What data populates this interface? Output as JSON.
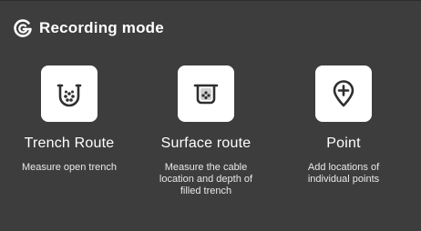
{
  "header": {
    "logo_icon": "brand-logo-icon",
    "title": "Recording mode"
  },
  "options": [
    {
      "label": "Trench Route",
      "description": "Measure open trench",
      "icon": "trench-cables-icon"
    },
    {
      "label": "Surface route",
      "description": "Measure the cable location and depth of filled trench",
      "icon": "filled-trench-icon"
    },
    {
      "label": "Point",
      "description": "Add locations of individual points",
      "icon": "map-pin-plus-icon"
    }
  ],
  "colors": {
    "background": "#3d3d3d",
    "tile": "#ffffff",
    "icon": "#2f2f2f",
    "text": "#ffffff"
  }
}
